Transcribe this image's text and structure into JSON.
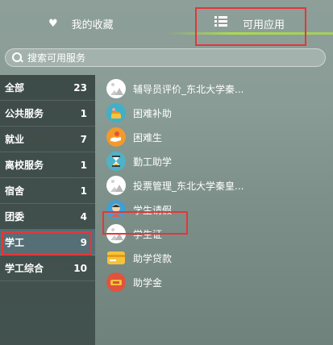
{
  "tabs": {
    "favorites_label": "我的收藏",
    "apps_label": "可用应用",
    "favorites_icon": "heart-icon",
    "apps_icon": "list-icon"
  },
  "search": {
    "placeholder": "搜索可用服务"
  },
  "categories": [
    {
      "label": "全部",
      "count": "23"
    },
    {
      "label": "公共服务",
      "count": "1"
    },
    {
      "label": "就业",
      "count": "7"
    },
    {
      "label": "离校服务",
      "count": "1"
    },
    {
      "label": "宿舍",
      "count": "1"
    },
    {
      "label": "团委",
      "count": "4"
    },
    {
      "label": "学工",
      "count": "9"
    },
    {
      "label": "学工综合",
      "count": "10"
    }
  ],
  "apps": [
    {
      "label": "辅导员评价_东北大学秦...",
      "icon": "image-placeholder-icon"
    },
    {
      "label": "困难补助",
      "icon": "money-bag-icon"
    },
    {
      "label": "困难生",
      "icon": "helping-hand-icon"
    },
    {
      "label": "勤工助学",
      "icon": "hourglass-icon"
    },
    {
      "label": "投票管理_东北大学秦皇...",
      "icon": "image-placeholder-icon"
    },
    {
      "label": "学生请假",
      "icon": "student-icon"
    },
    {
      "label": "学生证",
      "icon": "image-placeholder-icon"
    },
    {
      "label": "助学贷款",
      "icon": "card-icon"
    },
    {
      "label": "助学金",
      "icon": "grant-icon"
    }
  ],
  "colors": {
    "highlight_box": "#e53638",
    "active_tab_underline": "#aee146",
    "active_category_bg": "#566e75"
  }
}
